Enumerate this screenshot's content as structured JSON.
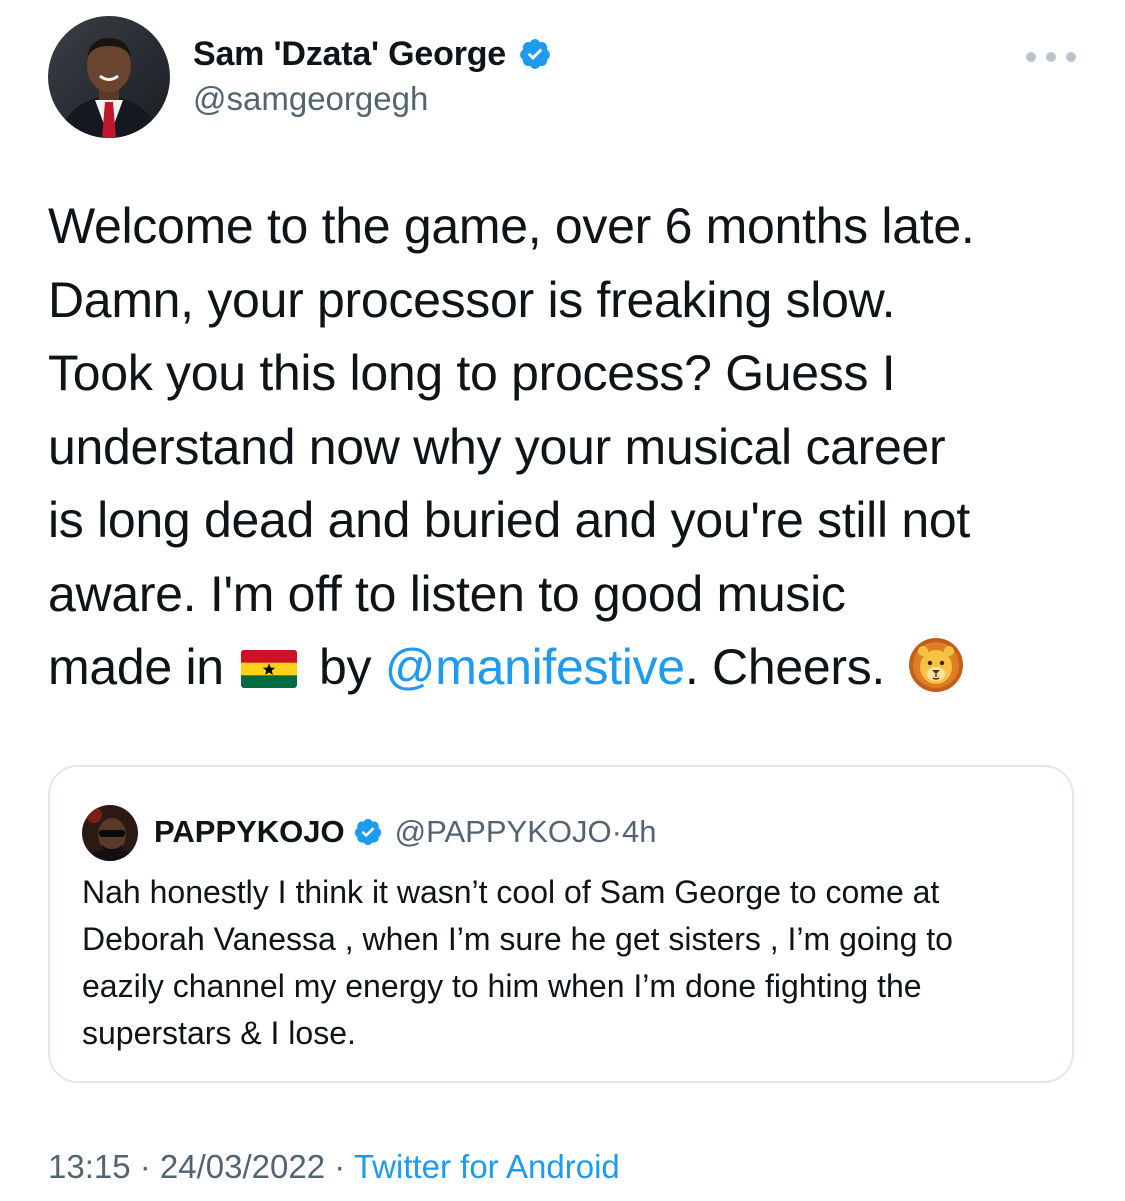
{
  "tweet": {
    "author": {
      "name": "Sam 'Dzata' George",
      "handle": "@samgeorgegh",
      "verified": true
    },
    "text_segments": {
      "line1": "Welcome to the game, over 6 months late.",
      "line2": "Damn, your processor is freaking slow.",
      "line3": "Took you this long to process? Guess I",
      "line4": "understand now why your musical career",
      "line5": "is long dead and buried and you're still not",
      "line6": "aware. I'm off to listen to good music",
      "line7_start": "made in ",
      "line7_by": " by ",
      "mention": "@manifestive",
      "line7_end": ". Cheers. "
    },
    "emojis": {
      "flag": "ghana-flag",
      "lion": "lion-face"
    },
    "timestamp": "13:15 · 24/03/2022 · ",
    "source": "Twitter for Android"
  },
  "quote": {
    "author": {
      "name": "PAPPYKOJO",
      "handle": "@PAPPYKOJO",
      "verified": true
    },
    "time_separator": " · ",
    "time": "4h",
    "text": "Nah honestly I think it wasn’t cool of Sam George to come at Deborah Vanessa , when I’m sure he get sisters , I’m going to eazily channel my energy to him when I’m done fighting the superstars & I lose."
  },
  "colors": {
    "text": "#0f1419",
    "secondary": "#536471",
    "link": "#1d9bf0",
    "verified": "#1d9bf0",
    "border": "#e1e8ed"
  }
}
